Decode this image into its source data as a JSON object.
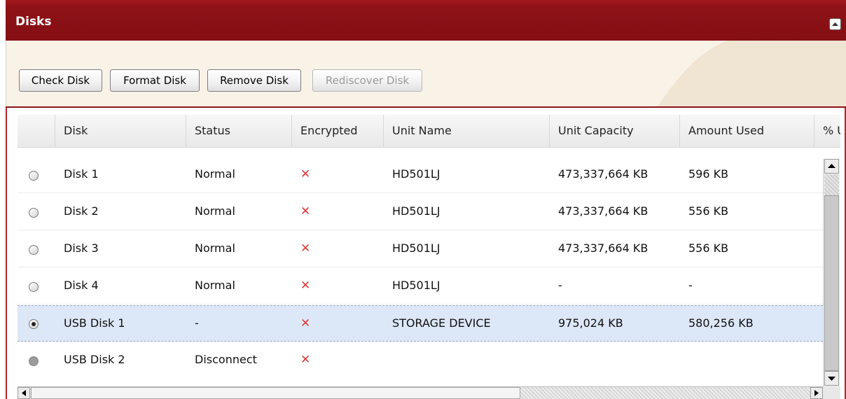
{
  "panel": {
    "title": "Disks"
  },
  "toolbar": {
    "check_disk": "Check Disk",
    "format_disk": "Format Disk",
    "remove_disk": "Remove Disk",
    "rediscover_disk": "Rediscover Disk"
  },
  "table": {
    "columns": [
      "Disk",
      "Status",
      "Encrypted",
      "Unit Name",
      "Unit Capacity",
      "Amount Used",
      "% U"
    ],
    "rows": [
      {
        "disk": "Disk 1",
        "status": "Normal",
        "encrypted": "✕",
        "unit_name": "HD501LJ",
        "unit_capacity": "473,337,664 KB",
        "amount_used": "596 KB",
        "selected": false
      },
      {
        "disk": "Disk 2",
        "status": "Normal",
        "encrypted": "✕",
        "unit_name": "HD501LJ",
        "unit_capacity": "473,337,664 KB",
        "amount_used": "556 KB",
        "selected": false
      },
      {
        "disk": "Disk 3",
        "status": "Normal",
        "encrypted": "✕",
        "unit_name": "HD501LJ",
        "unit_capacity": "473,337,664 KB",
        "amount_used": "556 KB",
        "selected": false
      },
      {
        "disk": "Disk 4",
        "status": "Normal",
        "encrypted": "✕",
        "unit_name": "HD501LJ",
        "unit_capacity": "-",
        "amount_used": "-",
        "selected": false
      },
      {
        "disk": "USB Disk 1",
        "status": "-",
        "encrypted": "✕",
        "unit_name": "STORAGE DEVICE",
        "unit_capacity": "975,024 KB",
        "amount_used": "580,256 KB",
        "selected": true
      },
      {
        "disk": "USB Disk 2",
        "status": "Disconnect",
        "encrypted": "✕",
        "unit_name": "",
        "unit_capacity": "",
        "amount_used": "",
        "selected": false
      }
    ]
  },
  "colors": {
    "header_red": "#8d1217",
    "toolbar_bg": "#f9f2e7",
    "selected_row": "#dce7f7",
    "x_mark": "#e03a3a"
  },
  "icons": {
    "collapse": "collapse-up-icon",
    "radio": "radio-icon",
    "x": "x-mark-icon"
  }
}
